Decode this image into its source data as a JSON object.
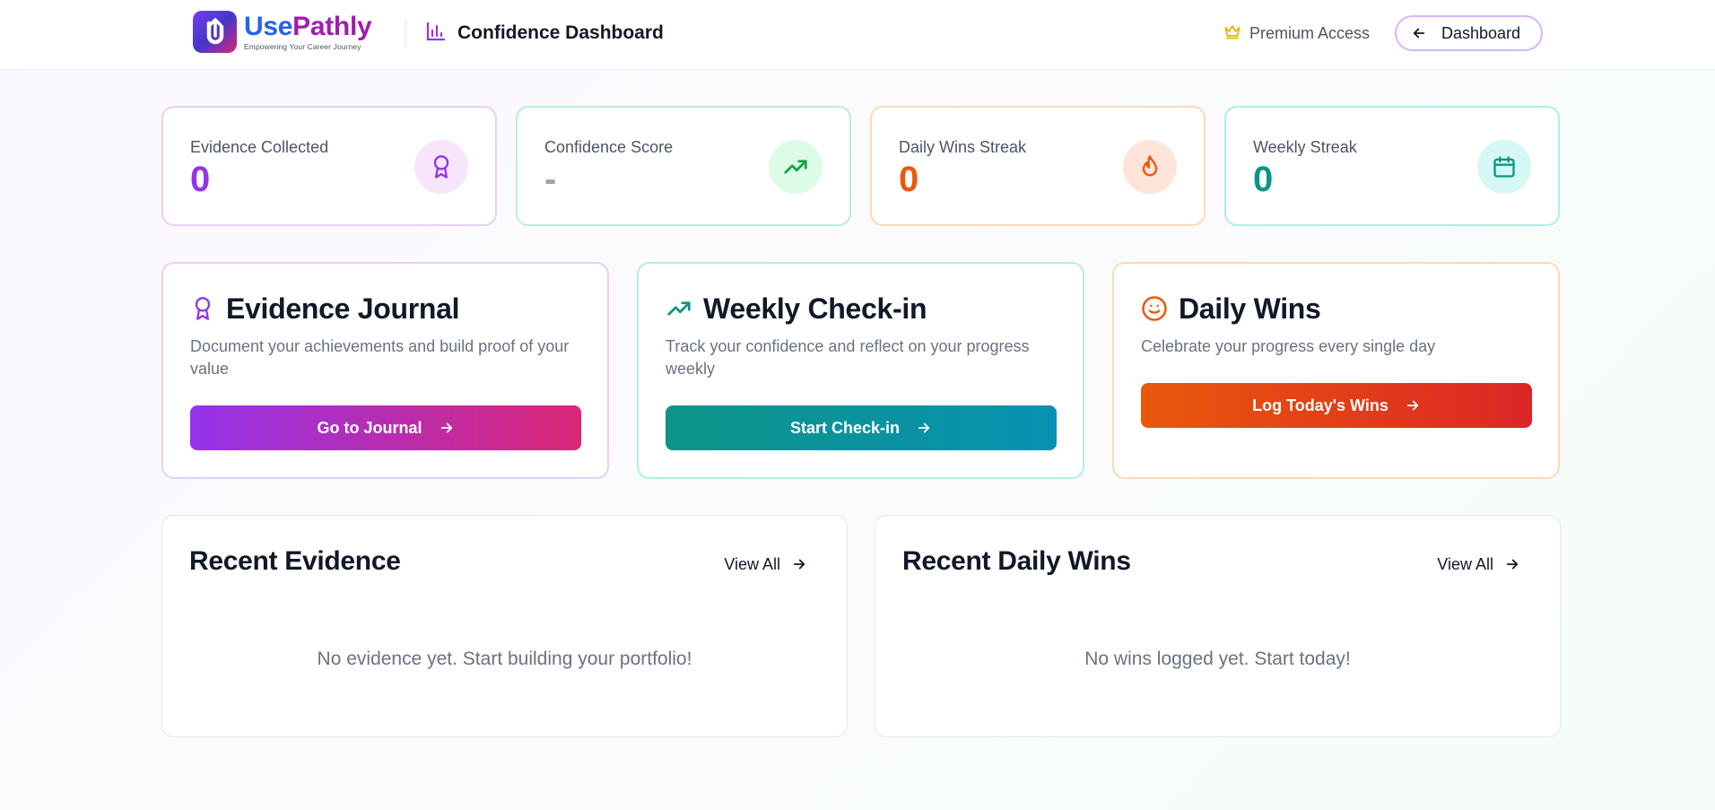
{
  "header": {
    "logo": {
      "name_part1": "Use",
      "name_part2": "Pathly",
      "tagline": "Empowering Your Career Journey"
    },
    "title": "Confidence Dashboard",
    "title_icon": "bar-chart-icon",
    "premium_label": "Premium Access",
    "premium_icon": "crown-icon",
    "dashboard_button": "Dashboard",
    "dashboard_icon": "arrow-left-icon"
  },
  "stats": [
    {
      "label": "Evidence Collected",
      "value": "0",
      "icon": "award-icon",
      "color": "#9333ea",
      "border": "#e9cff9",
      "icon_bg": "#f7e6fb"
    },
    {
      "label": "Confidence Score",
      "value": "-",
      "icon": "trending-up-icon",
      "color": "#9ca3af",
      "border": "#bbf0d6",
      "icon_bg": "#dcfce7"
    },
    {
      "label": "Daily Wins Streak",
      "value": "0",
      "icon": "flame-icon",
      "color": "#ea580c",
      "border": "#fdd9b6",
      "icon_bg": "#ffe4d9"
    },
    {
      "label": "Weekly Streak",
      "value": "0",
      "icon": "calendar-icon",
      "color": "#0d9488",
      "border": "#aef0e5",
      "icon_bg": "#d5f8f4"
    }
  ],
  "actions": [
    {
      "title": "Evidence Journal",
      "description": "Document your achievements and build proof of your value",
      "button": "Go to Journal",
      "icon": "award-icon"
    },
    {
      "title": "Weekly Check-in",
      "description": "Track your confidence and reflect on your progress weekly",
      "button": "Start Check-in",
      "icon": "trending-up-icon"
    },
    {
      "title": "Daily Wins",
      "description": "Celebrate your progress every single day",
      "button": "Log Today's Wins",
      "icon": "smile-icon"
    }
  ],
  "recent": [
    {
      "title": "Recent Evidence",
      "view_all": "View All",
      "empty": "No evidence yet. Start building your portfolio!"
    },
    {
      "title": "Recent Daily Wins",
      "view_all": "View All",
      "empty": "No wins logged yet. Start today!"
    }
  ],
  "colors": {
    "purple": "#9333ea",
    "pink": "#db2777",
    "teal": "#0d9488",
    "cyan": "#0891b2",
    "orange": "#ea580c",
    "red": "#dc2626"
  }
}
